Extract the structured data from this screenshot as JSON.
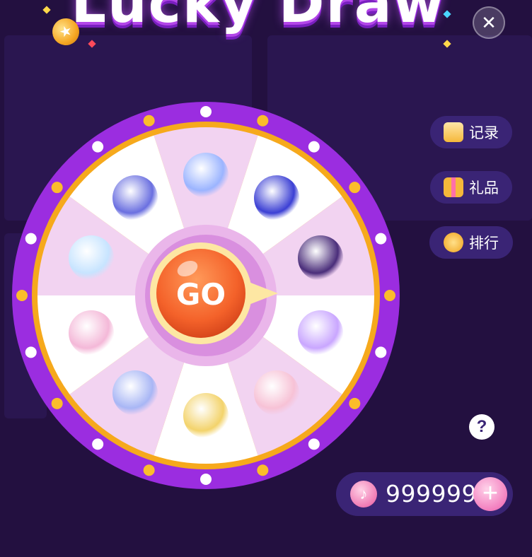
{
  "header": {
    "title": "Lucky Draw",
    "close_glyph": "✕"
  },
  "side_menu": {
    "records_label": "记录",
    "gifts_label": "礼品",
    "rank_label": "排行"
  },
  "wheel": {
    "go_label": "GO",
    "rim_color": "#9b2de0",
    "inner_ring_color": "#f6a91c",
    "slice_colors": [
      "#f2d3f1",
      "#ffffff"
    ],
    "prizes": [
      {
        "name": "crystal-gourd-gift-icon",
        "color": "#9bb4ff"
      },
      {
        "name": "crystal-jellyfish-gift-icon",
        "color": "#3b3fd4"
      },
      {
        "name": "princess-avatar-frame-icon",
        "color": "#4a2d7a"
      },
      {
        "name": "heart-ring-gift-icon",
        "color": "#c9a6ff"
      },
      {
        "name": "shell-crown-gift-icon",
        "color": "#f7c2d6"
      },
      {
        "name": "cartoon-girl-gift-icon",
        "color": "#f3d36b"
      },
      {
        "name": "seashell-gift-icon",
        "color": "#a8b6f5"
      },
      {
        "name": "angel-wings-gift-icon",
        "color": "#f4b8d8"
      },
      {
        "name": "snowman-gift-icon",
        "color": "#c7e4ff"
      },
      {
        "name": "crystal-ball-gift-icon",
        "color": "#6a6fe0"
      }
    ]
  },
  "help": {
    "glyph": "?"
  },
  "balance": {
    "amount": "999999",
    "currency_icon": "music-note-coin-icon",
    "add_glyph": "+"
  }
}
